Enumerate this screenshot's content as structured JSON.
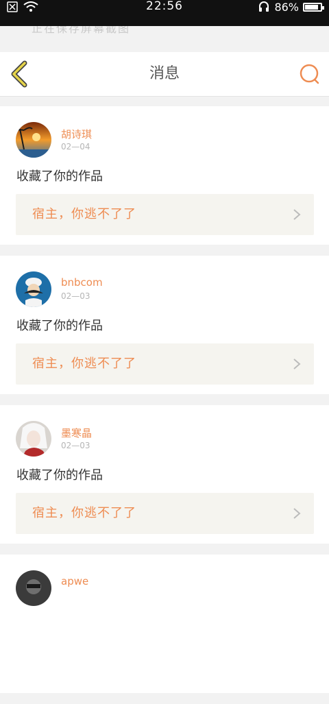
{
  "status_bar": {
    "time": "22:56",
    "battery": "86%",
    "battery_level": 0.86
  },
  "toast": {
    "text": "正在保存屏幕截图"
  },
  "header": {
    "title": "消息",
    "back_icon": "chevron-left-icon",
    "search_icon": "search-icon"
  },
  "messages": [
    {
      "user": "胡诗琪",
      "date": "02—04",
      "action": "收藏了你的作品",
      "work_title": "宿主，你逃不了了"
    },
    {
      "user": "bnbcom",
      "date": "02—03",
      "action": "收藏了你的作品",
      "work_title": "宿主，你逃不了了"
    },
    {
      "user": "墨寒晶",
      "date": "02—03",
      "action": "收藏了你的作品",
      "work_title": "宿主，你逃不了了"
    },
    {
      "user": "apwe",
      "date": "",
      "action": "",
      "work_title": ""
    }
  ],
  "colors": {
    "accent": "#ee8c52",
    "back_icon": "#e6d44a",
    "card_inner": "#f5f4ef"
  }
}
